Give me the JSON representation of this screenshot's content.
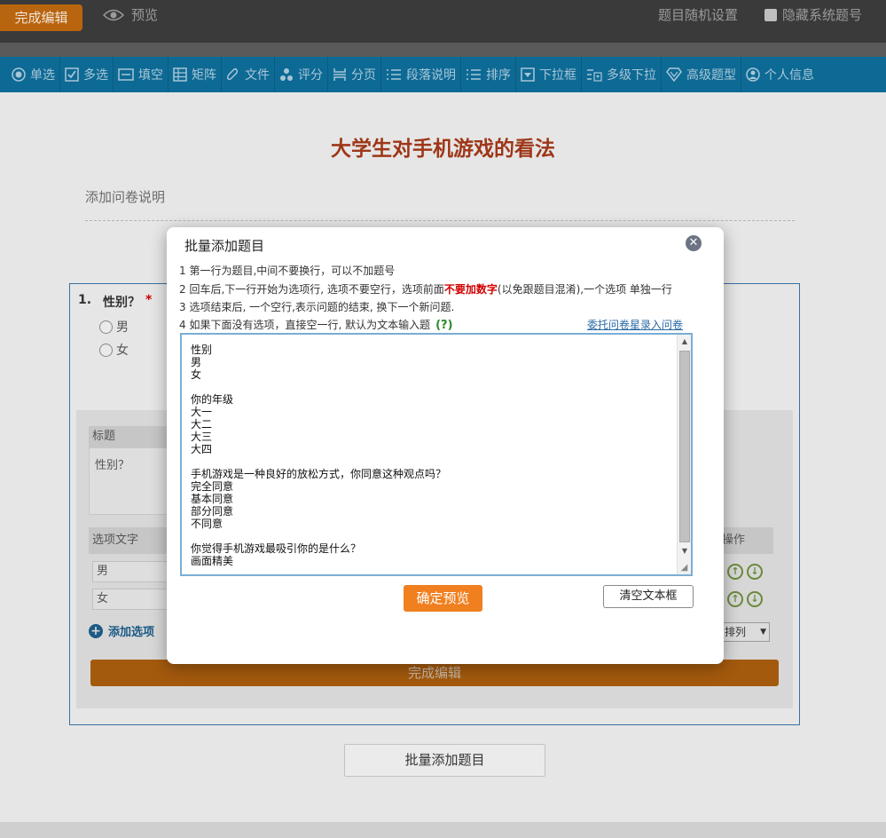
{
  "topbar": {
    "done_label": "完成编辑",
    "preview_label": "预览",
    "random_setting": "题目随机设置",
    "hide_system_numbers": "隐藏系统题号"
  },
  "toolbar": {
    "items": [
      {
        "label": "单选",
        "icon": "radio-icon"
      },
      {
        "label": "多选",
        "icon": "checkbox-icon"
      },
      {
        "label": "填空",
        "icon": "fill-blank-icon"
      },
      {
        "label": "矩阵",
        "icon": "matrix-icon"
      },
      {
        "label": "文件",
        "icon": "paperclip-icon"
      },
      {
        "label": "评分",
        "icon": "rating-icon"
      },
      {
        "label": "分页",
        "icon": "page-break-icon"
      },
      {
        "label": "段落说明",
        "icon": "paragraph-icon"
      },
      {
        "label": "排序",
        "icon": "sort-icon"
      },
      {
        "label": "下拉框",
        "icon": "dropdown-icon"
      },
      {
        "label": "多级下拉",
        "icon": "multi-dropdown-icon"
      },
      {
        "label": "高级题型",
        "icon": "diamond-icon"
      },
      {
        "label": "个人信息",
        "icon": "user-icon"
      }
    ]
  },
  "survey": {
    "title": "大学生对手机游戏的看法",
    "add_description": "添加问卷说明"
  },
  "question": {
    "number": "1.",
    "text": "性别？",
    "required_mark": "*",
    "options": [
      "男",
      "女"
    ]
  },
  "editor": {
    "title_label": "标题",
    "title_value": "性别？",
    "option_text_header": "选项文字",
    "operation_header": "操作",
    "option_values": [
      "男",
      "女"
    ],
    "add_option": "添加选项",
    "sort_select": "排列",
    "done_button": "完成编辑"
  },
  "batch_button": "批量添加题目",
  "modal": {
    "title": "批量添加题目",
    "close_symbol": "✕",
    "instr1": "1 第一行为题目,中间不要换行，可以不加题号",
    "instr2_pre": "2 回车后,下一行开始为选项行, 选项不要空行，选项前面",
    "instr2_red": "不要加数字",
    "instr2_post": "(以免跟题目混淆),一个选项 单独一行",
    "instr3": "3 选项结束后, 一个空行,表示问题的结束, 换下一个新问题.",
    "instr4": "4 如果下面没有选项，直接空一行, 默认为文本输入题",
    "help": "(?)",
    "delegate_link": "委托问卷星录入问卷",
    "textarea": "性别\n男\n女\n\n你的年级\n大一\n大二\n大三\n大四\n\n手机游戏是一种良好的放松方式，你同意这种观点吗？\n完全同意\n基本同意\n部分同意\n不同意\n\n你觉得手机游戏最吸引你的是什么？\n画面精美",
    "confirm_button": "确定预览",
    "clear_button": "清空文本框"
  }
}
